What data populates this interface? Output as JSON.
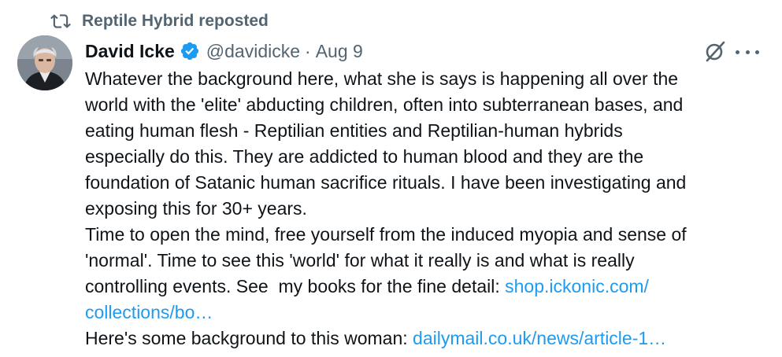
{
  "repost": {
    "label": "Reptile Hybrid reposted",
    "icon": "repost-icon"
  },
  "author": {
    "name": "David Icke",
    "verified_icon": "verified-badge-icon",
    "handle": "@davidicke",
    "separator": "·",
    "time": "Aug 9"
  },
  "actions": {
    "grok_icon": "grok-icon",
    "more_icon": "more-options-icon"
  },
  "tweet": {
    "lines": [
      "Whatever the background here, what she is says is happening all over the",
      "world with the 'elite' abducting children, often into subterranean bases, and",
      "eating human flesh - Reptilian entities and Reptilian-human hybrids",
      "especially do this. They are addicted to human blood and they are the",
      "foundation of Satanic human sacrifice rituals. I have been investigating and",
      "exposing this for 30+ years.",
      "Time to open the mind, free yourself from the induced myopia and sense of",
      "'normal'. Time to see this 'world' for what it really is and what is really"
    ],
    "line9_text": "controlling events. See  my books for the fine detail: ",
    "line9_link": "shop.ickonic.com/",
    "line10_link": "collections/bo…",
    "line11_text": "Here's some background to this woman: ",
    "line11_link": "dailymail.co.uk/news/article-1…"
  },
  "colors": {
    "text": "#0f1419",
    "secondary": "#536471",
    "link": "#1d9bf0",
    "verified": "#1d9bf0"
  }
}
